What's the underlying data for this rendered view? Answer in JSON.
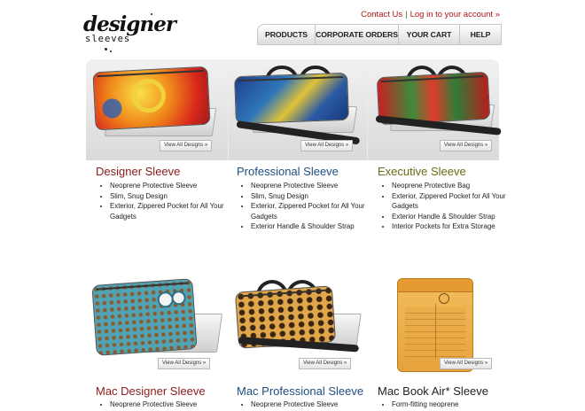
{
  "logo": {
    "line1": "designer",
    "line2": "sleeves"
  },
  "header": {
    "contact": "Contact Us",
    "separator": "|",
    "login": "Log in to your account »"
  },
  "nav": [
    {
      "label": "PRODUCTS"
    },
    {
      "label": "CORPORATE ORDERS"
    },
    {
      "label": "YOUR CART"
    },
    {
      "label": "HELP"
    }
  ],
  "view_label": "View All Designs »",
  "colors": {
    "red": "#8b1a1a",
    "blue": "#1d4d80",
    "olive": "#6b6b14",
    "link": "#b01414"
  },
  "products": [
    {
      "title": "Designer Sleeve",
      "features": [
        "Neoprene Protective Sleeve",
        "Slim, Snug Design",
        "Exterior, Zippered Pocket for All Your Gadgets"
      ]
    },
    {
      "title": "Professional Sleeve",
      "features": [
        "Neoprene Protective Sleeve",
        "Slim, Snug Design",
        "Exterior, Zippered Pocket for All Your Gadgets",
        "Exterior Handle & Shoulder Strap"
      ]
    },
    {
      "title": "Executive Sleeve",
      "features": [
        "Neoprene Protective Bag",
        "Exterior, Zippered Pocket for All Your Gadgets",
        "Exterior Handle & Shoulder Strap",
        "Interior Pockets for Extra Storage"
      ]
    },
    {
      "title": "Mac Designer Sleeve",
      "features": [
        "Neoprene Protective Sleeve"
      ]
    },
    {
      "title": "Mac Professional Sleeve",
      "features": [
        "Neoprene Protective Sleeve"
      ]
    },
    {
      "title": "Mac Book Air* Sleeve",
      "features": [
        "Form-fitting neoprene"
      ]
    }
  ]
}
